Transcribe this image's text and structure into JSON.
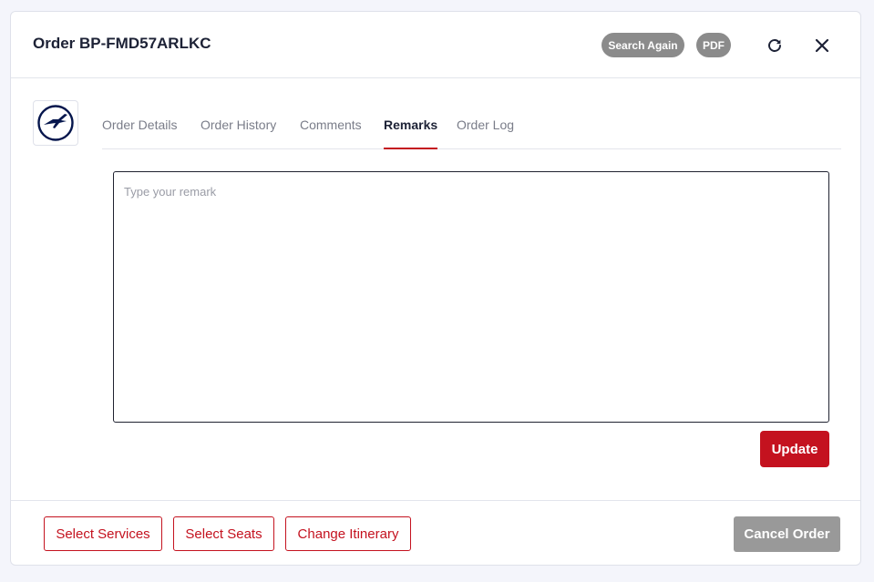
{
  "header": {
    "title": "Order BP-FMD57ARLKC",
    "search_again_label": "Search Again",
    "pdf_label": "PDF",
    "refresh_icon": "refresh-icon",
    "close_icon": "close-icon"
  },
  "logo": {
    "icon": "crane-airline-logo",
    "color": "#05164d"
  },
  "tabs": [
    {
      "label": "Order Details",
      "active": false
    },
    {
      "label": "Order History",
      "active": false
    },
    {
      "label": "Comments",
      "active": false
    },
    {
      "label": "Remarks",
      "active": true
    },
    {
      "label": "Order Log",
      "active": false
    }
  ],
  "remark": {
    "value": "",
    "placeholder": "Type your remark"
  },
  "update_label": "Update",
  "footer": {
    "select_services_label": "Select Services",
    "select_seats_label": "Select Seats",
    "change_itinerary_label": "Change Itinerary",
    "cancel_order_label": "Cancel Order"
  },
  "colors": {
    "accent": "#c4121f",
    "pill_gray": "#8b8b8b",
    "disabled_gray": "#999999",
    "text_dark": "#1d2236"
  }
}
